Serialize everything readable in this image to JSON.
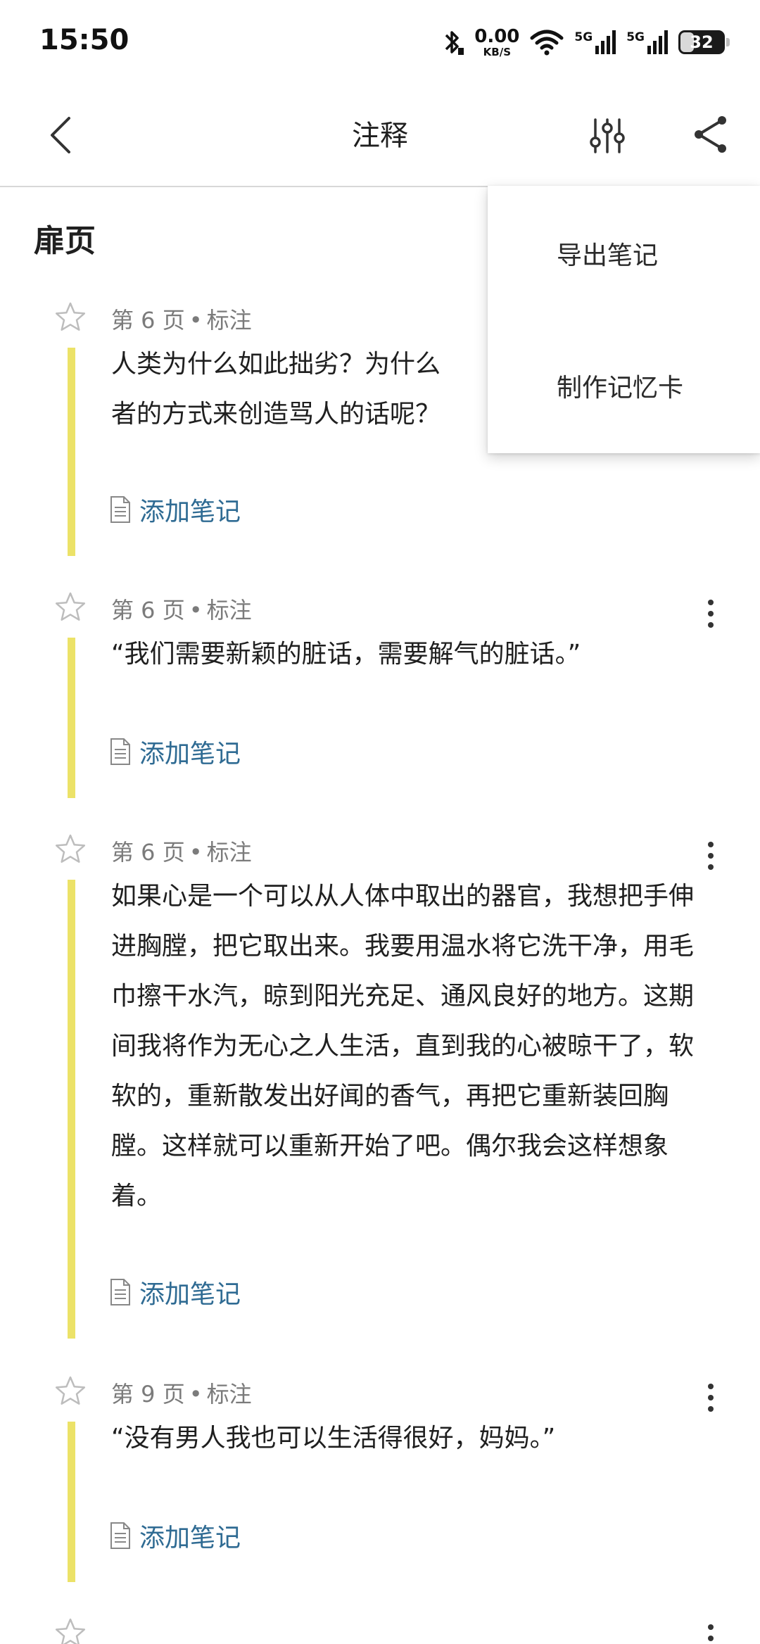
{
  "status_bar": {
    "time": "15:50",
    "net_speed_value": "0.00",
    "net_speed_unit": "KB/S",
    "network_1": "5G",
    "network_2": "5G",
    "battery_level": "32",
    "battery_fraction": 0.32,
    "icons": [
      "bluetooth-icon",
      "wifi-icon",
      "signal-icon",
      "battery-icon"
    ]
  },
  "header": {
    "title": "注释",
    "back_icon": "chevron-left-icon",
    "filter_icon": "sliders-icon",
    "share_icon": "share-icon"
  },
  "section": {
    "title": "扉页"
  },
  "annotations": [
    {
      "page": "第 6 页",
      "separator": "•",
      "kind": "标注",
      "text": "人类为什么如此拙劣？为什么\n者的方式来创造骂人的话呢？",
      "add_note": "添加笔记"
    },
    {
      "page": "第 6 页",
      "separator": "•",
      "kind": "标注",
      "text": "“我们需要新颖的脏话，需要解气的脏话。”",
      "add_note": "添加笔记"
    },
    {
      "page": "第 6 页",
      "separator": "•",
      "kind": "标注",
      "text": "如果心是一个可以从人体中取出的器官，我想把手伸进胸膛，把它取出来。我要用温水将它洗干净，用毛巾擦干水汽，晾到阳光充足、通风良好的地方。这期间我将作为无心之人生活，直到我的心被晾干了，软软的，重新散发出好闻的香气，再把它重新装回胸膛。这样就可以重新开始了吧。偶尔我会这样想象着。",
      "add_note": "添加笔记"
    },
    {
      "page": "第 9 页",
      "separator": "•",
      "kind": "标注",
      "text": "“没有男人我也可以生活得很好，妈妈。”",
      "add_note": "添加笔记"
    }
  ],
  "menu": {
    "items": [
      "导出笔记",
      "制作记忆卡"
    ]
  },
  "colors": {
    "highlight_bar": "#ece268",
    "link": "#2f6b93",
    "meta_text": "#7b7b7b"
  }
}
